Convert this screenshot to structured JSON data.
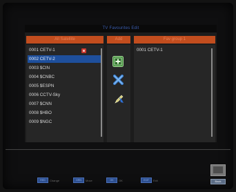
{
  "title": "TV Favourites Edit",
  "columns": {
    "left": "All Satellite",
    "middle": "Add",
    "right": "Fav group 1"
  },
  "left_list": [
    {
      "label": "0001 CETV-1",
      "selected": false,
      "locked": true
    },
    {
      "label": "0002 CETV-2",
      "selected": true,
      "locked": false
    },
    {
      "label": "0003 $CIN",
      "selected": false,
      "locked": false
    },
    {
      "label": "0004 $CNBC",
      "selected": false,
      "locked": false
    },
    {
      "label": "0005 $ESPN",
      "selected": false,
      "locked": false
    },
    {
      "label": "0006 CCTV-Sky",
      "selected": false,
      "locked": false
    },
    {
      "label": "0007 $CNN",
      "selected": false,
      "locked": false
    },
    {
      "label": "0008 $HBO",
      "selected": false,
      "locked": false
    },
    {
      "label": "0009 $NGC",
      "selected": false,
      "locked": false
    }
  ],
  "right_list": [
    {
      "label": "0001 CETV-1"
    }
  ],
  "action_icons": [
    "add-icon",
    "delete-icon",
    "edit-icon"
  ],
  "footer_keys": [
    {
      "cap": "RED",
      "label": "Change"
    },
    {
      "cap": "GRN",
      "label": "Move"
    },
    {
      "cap": "OK",
      "label": "OK"
    },
    {
      "cap": "EXIT",
      "label": "Exit"
    }
  ],
  "back_label": "Back",
  "colors": {
    "header": "#c24d1e",
    "selection": "#1e4f9c",
    "title": "#3c5fb3"
  }
}
